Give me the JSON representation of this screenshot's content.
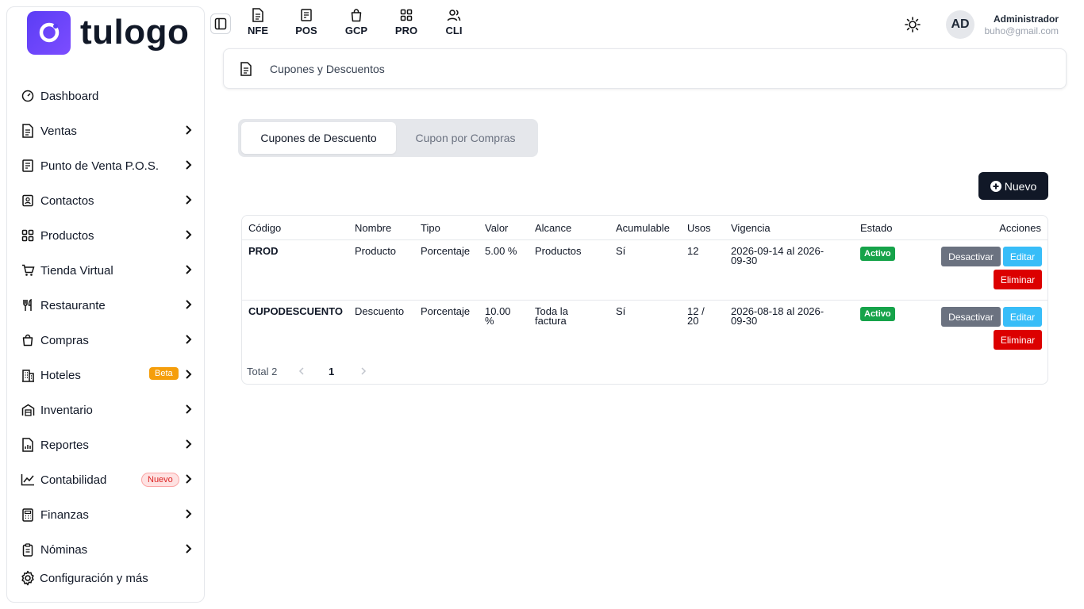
{
  "brand": {
    "name": "tulogo",
    "color": "#5b3df5"
  },
  "sidebar": {
    "items": [
      {
        "label": "Dashboard",
        "icon": "dashboard-icon",
        "chevron": false
      },
      {
        "label": "Ventas",
        "icon": "document-icon",
        "chevron": true
      },
      {
        "label": "Punto de Venta P.O.S.",
        "icon": "receipt-icon",
        "chevron": true
      },
      {
        "label": "Contactos",
        "icon": "contacts-icon",
        "chevron": true
      },
      {
        "label": "Productos",
        "icon": "grid-icon",
        "chevron": true
      },
      {
        "label": "Tienda Virtual",
        "icon": "cart-icon",
        "chevron": true
      },
      {
        "label": "Restaurante",
        "icon": "utensils-icon",
        "chevron": true
      },
      {
        "label": "Compras",
        "icon": "bag-icon",
        "chevron": true
      },
      {
        "label": "Hoteles",
        "icon": "building-icon",
        "chevron": true,
        "badge": "Beta"
      },
      {
        "label": "Inventario",
        "icon": "warehouse-icon",
        "chevron": true
      },
      {
        "label": "Reportes",
        "icon": "report-icon",
        "chevron": true
      },
      {
        "label": "Contabilidad",
        "icon": "chart-icon",
        "chevron": true,
        "badge": "Nuevo"
      },
      {
        "label": "Finanzas",
        "icon": "calculator-icon",
        "chevron": true
      },
      {
        "label": "Nóminas",
        "icon": "clipboard-icon",
        "chevron": true
      }
    ],
    "config_label": "Configuración y más"
  },
  "topnav": {
    "items": [
      {
        "label": "NFE",
        "icon": "document-icon"
      },
      {
        "label": "POS",
        "icon": "receipt-icon"
      },
      {
        "label": "GCP",
        "icon": "bag-icon"
      },
      {
        "label": "PRO",
        "icon": "grid-icon"
      },
      {
        "label": "CLI",
        "icon": "users-icon"
      }
    ]
  },
  "user": {
    "initials": "AD",
    "name": "Administrador",
    "email": "buho@gmail.com"
  },
  "breadcrumb": {
    "label": "Cupones y Descuentos"
  },
  "tabs": [
    {
      "label": "Cupones de Descuento",
      "active": true
    },
    {
      "label": "Cupon por Compras",
      "active": false
    }
  ],
  "new_button": {
    "label": "Nuevo"
  },
  "table": {
    "headers": [
      "Código",
      "Nombre",
      "Tipo",
      "Valor",
      "Alcance",
      "Acumulable",
      "Usos",
      "Vigencia",
      "Estado",
      "Acciones"
    ],
    "rows": [
      {
        "codigo": "PROD",
        "nombre": "Producto",
        "tipo": "Porcentaje",
        "valor": "5.00 %",
        "alcance": "Productos",
        "acumulable": "Sí",
        "usos": "12",
        "vigencia_1": "2026-09-14 al 2026-",
        "vigencia_2": "09-30",
        "estado": "Activo"
      },
      {
        "codigo": "CUPODESCUENTO",
        "nombre": "Descuento",
        "tipo": "Porcentaje",
        "valor_1": "10.00",
        "valor_2": "%",
        "alcance_1": "Toda la",
        "alcance_2": "factura",
        "acumulable": "Sí",
        "usos_1": "12 /",
        "usos_2": "20",
        "vigencia_1": "2026-08-18 al 2026-",
        "vigencia_2": "09-30",
        "estado": "Activo"
      }
    ],
    "actions": {
      "deactivate": "Desactivar",
      "edit": "Editar",
      "delete": "Eliminar"
    },
    "pagination": {
      "total_label": "Total 2",
      "current_page": "1"
    }
  },
  "colors": {
    "status_active": "#16a34a",
    "btn_deactivate": "#6b7280",
    "btn_edit": "#38bdf8",
    "btn_delete": "#dc0000",
    "btn_primary": "#111827"
  }
}
